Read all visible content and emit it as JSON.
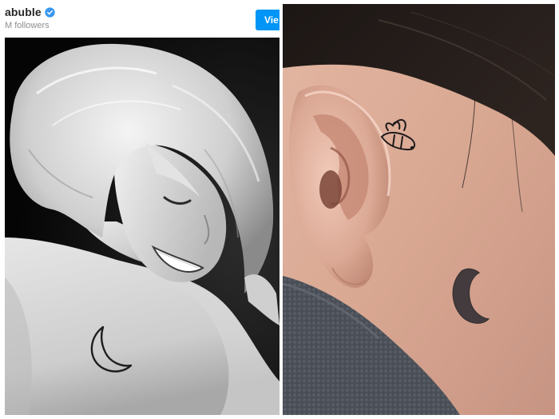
{
  "post": {
    "username": "abuble",
    "followers": "M followers",
    "view_button_label": "Vie"
  },
  "icons": {
    "verified": "verified-badge-icon"
  },
  "colors": {
    "verified_blue": "#3897f0",
    "button_blue": "#0095f6",
    "username_text": "#262626",
    "followers_text": "#8e8e8e"
  }
}
